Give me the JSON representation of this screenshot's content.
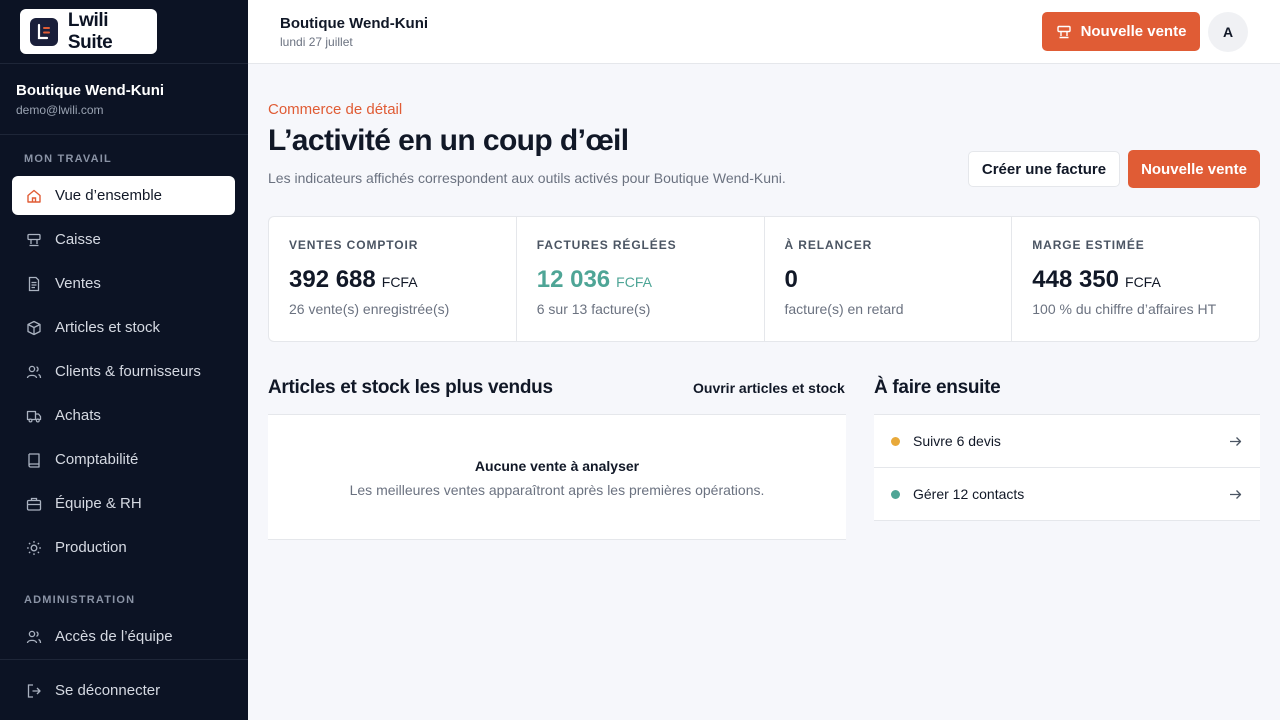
{
  "app": {
    "name": "Lwili Suite",
    "logo_letter": "L"
  },
  "account": {
    "name": "Boutique Wend-Kuni",
    "email": "demo@lwili.com"
  },
  "sidebar": {
    "section_work": "MON TRAVAIL",
    "items": [
      {
        "label": "Vue d’ensemble",
        "icon": "home-icon",
        "active": true
      },
      {
        "label": "Caisse",
        "icon": "register-icon"
      },
      {
        "label": "Ventes",
        "icon": "document-icon"
      },
      {
        "label": "Articles et stock",
        "icon": "box-icon"
      },
      {
        "label": "Clients & fournisseurs",
        "icon": "users-icon"
      },
      {
        "label": "Achats",
        "icon": "truck-icon"
      },
      {
        "label": "Comptabilité",
        "icon": "book-icon"
      },
      {
        "label": "Équipe & RH",
        "icon": "briefcase-icon"
      },
      {
        "label": "Production",
        "icon": "sun-icon"
      }
    ],
    "section_admin": "ADMINISTRATION",
    "admin_items": [
      {
        "label": "Accès de l’équipe",
        "icon": "users-icon"
      }
    ],
    "logout": {
      "label": "Se déconnecter",
      "icon": "logout-icon"
    }
  },
  "topbar": {
    "title": "Boutique Wend-Kuni",
    "date": "lundi 27 juillet",
    "new_sale_label": "Nouvelle vente",
    "avatar_initial": "A"
  },
  "header": {
    "eyebrow": "Commerce de détail",
    "title": "L’activité en un coup d’œil",
    "subtitle": "Les indicateurs affichés correspondent aux outils activés pour Boutique Wend-Kuni.",
    "create_invoice_label": "Créer une facture",
    "new_sale_label": "Nouvelle vente"
  },
  "kpis": [
    {
      "label": "VENTES COMPTOIR",
      "value": "392 688",
      "unit": "FCFA",
      "sub": "26 vente(s) enregistrée(s)"
    },
    {
      "label": "FACTURES RÉGLÉES",
      "value": "12 036",
      "unit": "FCFA",
      "sub": "6 sur 13 facture(s)",
      "accent": "#4ea596"
    },
    {
      "label": "À RELANCER",
      "value": "0",
      "unit": "",
      "sub": "facture(s) en retard"
    },
    {
      "label": "MARGE ESTIMÉE",
      "value": "448 350",
      "unit": "FCFA",
      "sub": "100 % du chiffre d’affaires HT"
    }
  ],
  "best_sellers": {
    "title": "Articles et stock les plus vendus",
    "link": "Ouvrir articles et stock",
    "empty_title": "Aucune vente à analyser",
    "empty_sub": "Les meilleures ventes apparaîtront après les premières opérations."
  },
  "todo": {
    "title": "À faire ensuite",
    "items": [
      {
        "label": "Suivre 6 devis",
        "dot_color": "#e8a93a"
      },
      {
        "label": "Gérer 12 contacts",
        "dot_color": "#4ea596"
      }
    ]
  },
  "colors": {
    "accent": "#e05c35",
    "sidebar_bg": "#0c1324",
    "success": "#4ea596",
    "warning": "#e8a93a"
  }
}
